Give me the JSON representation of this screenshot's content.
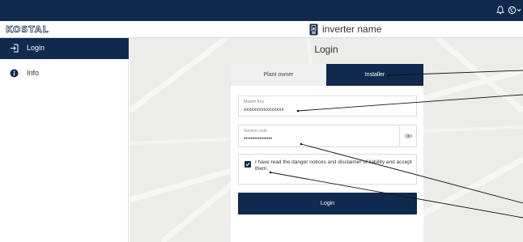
{
  "header": {
    "logo": "KOSTAL",
    "device_name": "inverter name"
  },
  "sidebar": {
    "items": [
      {
        "label": "Login",
        "icon": "login-icon",
        "active": true
      },
      {
        "label": "Info",
        "icon": "info-icon",
        "active": false
      }
    ]
  },
  "main": {
    "title": "Login"
  },
  "login_form": {
    "tabs": [
      {
        "label": "Plant owner",
        "selected": false
      },
      {
        "label": "Installer",
        "selected": true
      }
    ],
    "master_key": {
      "label": "Master Key",
      "value": "xxxxxxxxxxxxxxxx"
    },
    "service_code": {
      "label": "Service code",
      "value": "••••••••••••••••"
    },
    "consent": {
      "checked": true,
      "text": "I have read the danger notices and disclaimer of liability and accept them."
    },
    "submit_label": "Login"
  },
  "colors": {
    "primary": "#102a4e",
    "background": "#ecedea"
  },
  "topbar_icons": [
    "bell-icon",
    "globe-icon",
    "chevron-down-icon"
  ]
}
